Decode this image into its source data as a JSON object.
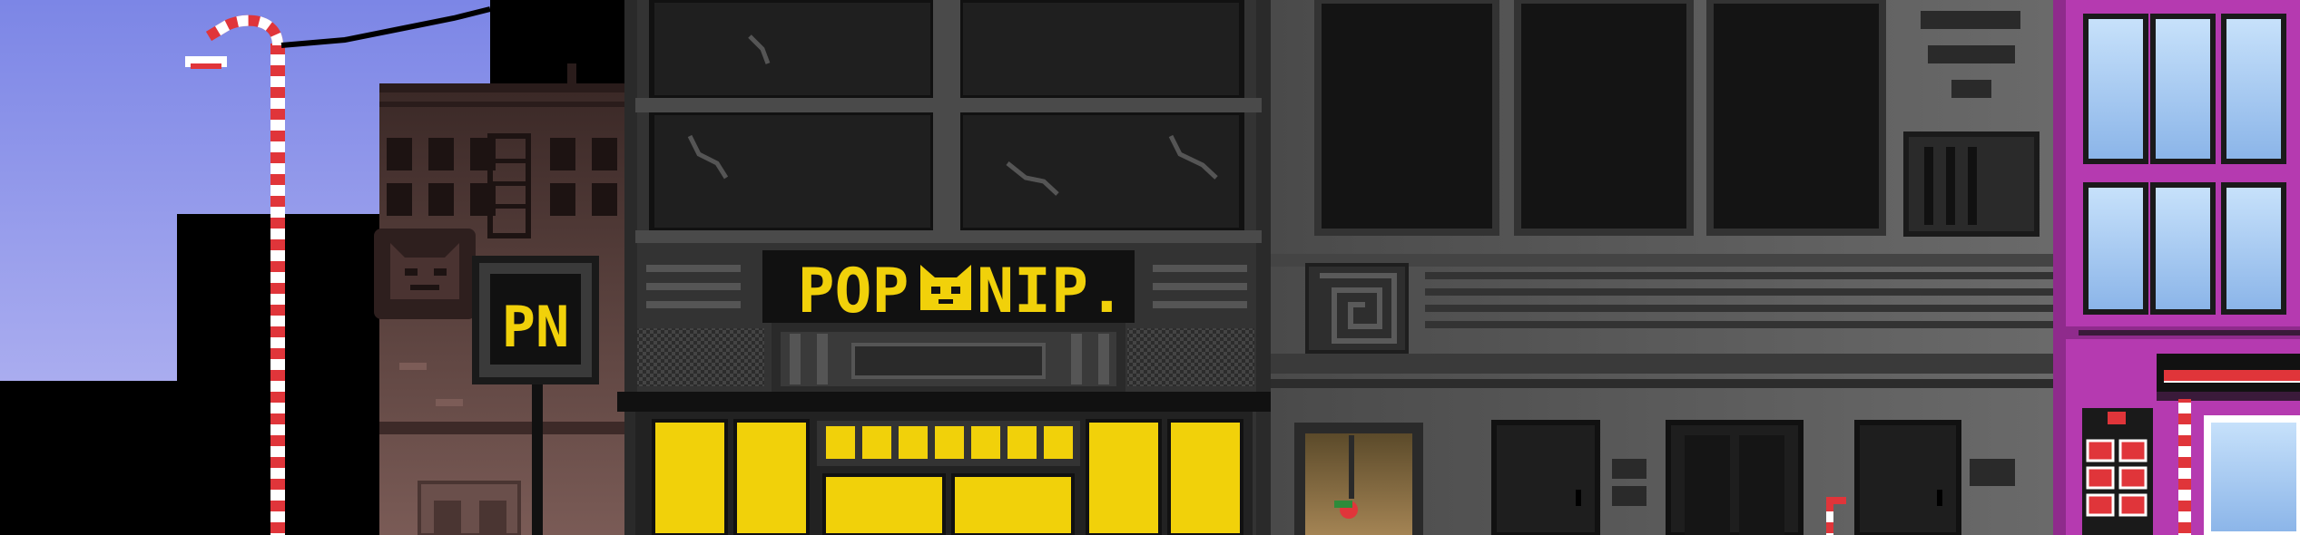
{
  "scene": {
    "colors": {
      "sky_top": "#7f88e6",
      "sky_bottom": "#b7b9f2",
      "silhouette": "#000000",
      "brick_dark": "#3d2a28",
      "brick_mid": "#5a4240",
      "brick_light": "#7a5a55",
      "store_bg": "#2f2f2f",
      "store_panel": "#1f1f1f",
      "neon_yellow": "#f1d10a",
      "gray_building": "#5a5a5a",
      "gray_dark": "#141414",
      "pink_building": "#b53ab0",
      "window_blue": "#a9cbf0",
      "candy_red": "#e0353a",
      "candy_white": "#ffffff"
    }
  },
  "storefront": {
    "sign_label": "POP NIP",
    "sign_left": "POP",
    "sign_right": "NIP.",
    "emblem_icon": "cat-face-icon"
  },
  "small_sign": {
    "label": "PN"
  },
  "icons": {
    "lamp": "candy-cane-streetlamp-icon",
    "gargoyle": "cat-gargoyle-icon",
    "emblem": "cat-face-icon"
  }
}
